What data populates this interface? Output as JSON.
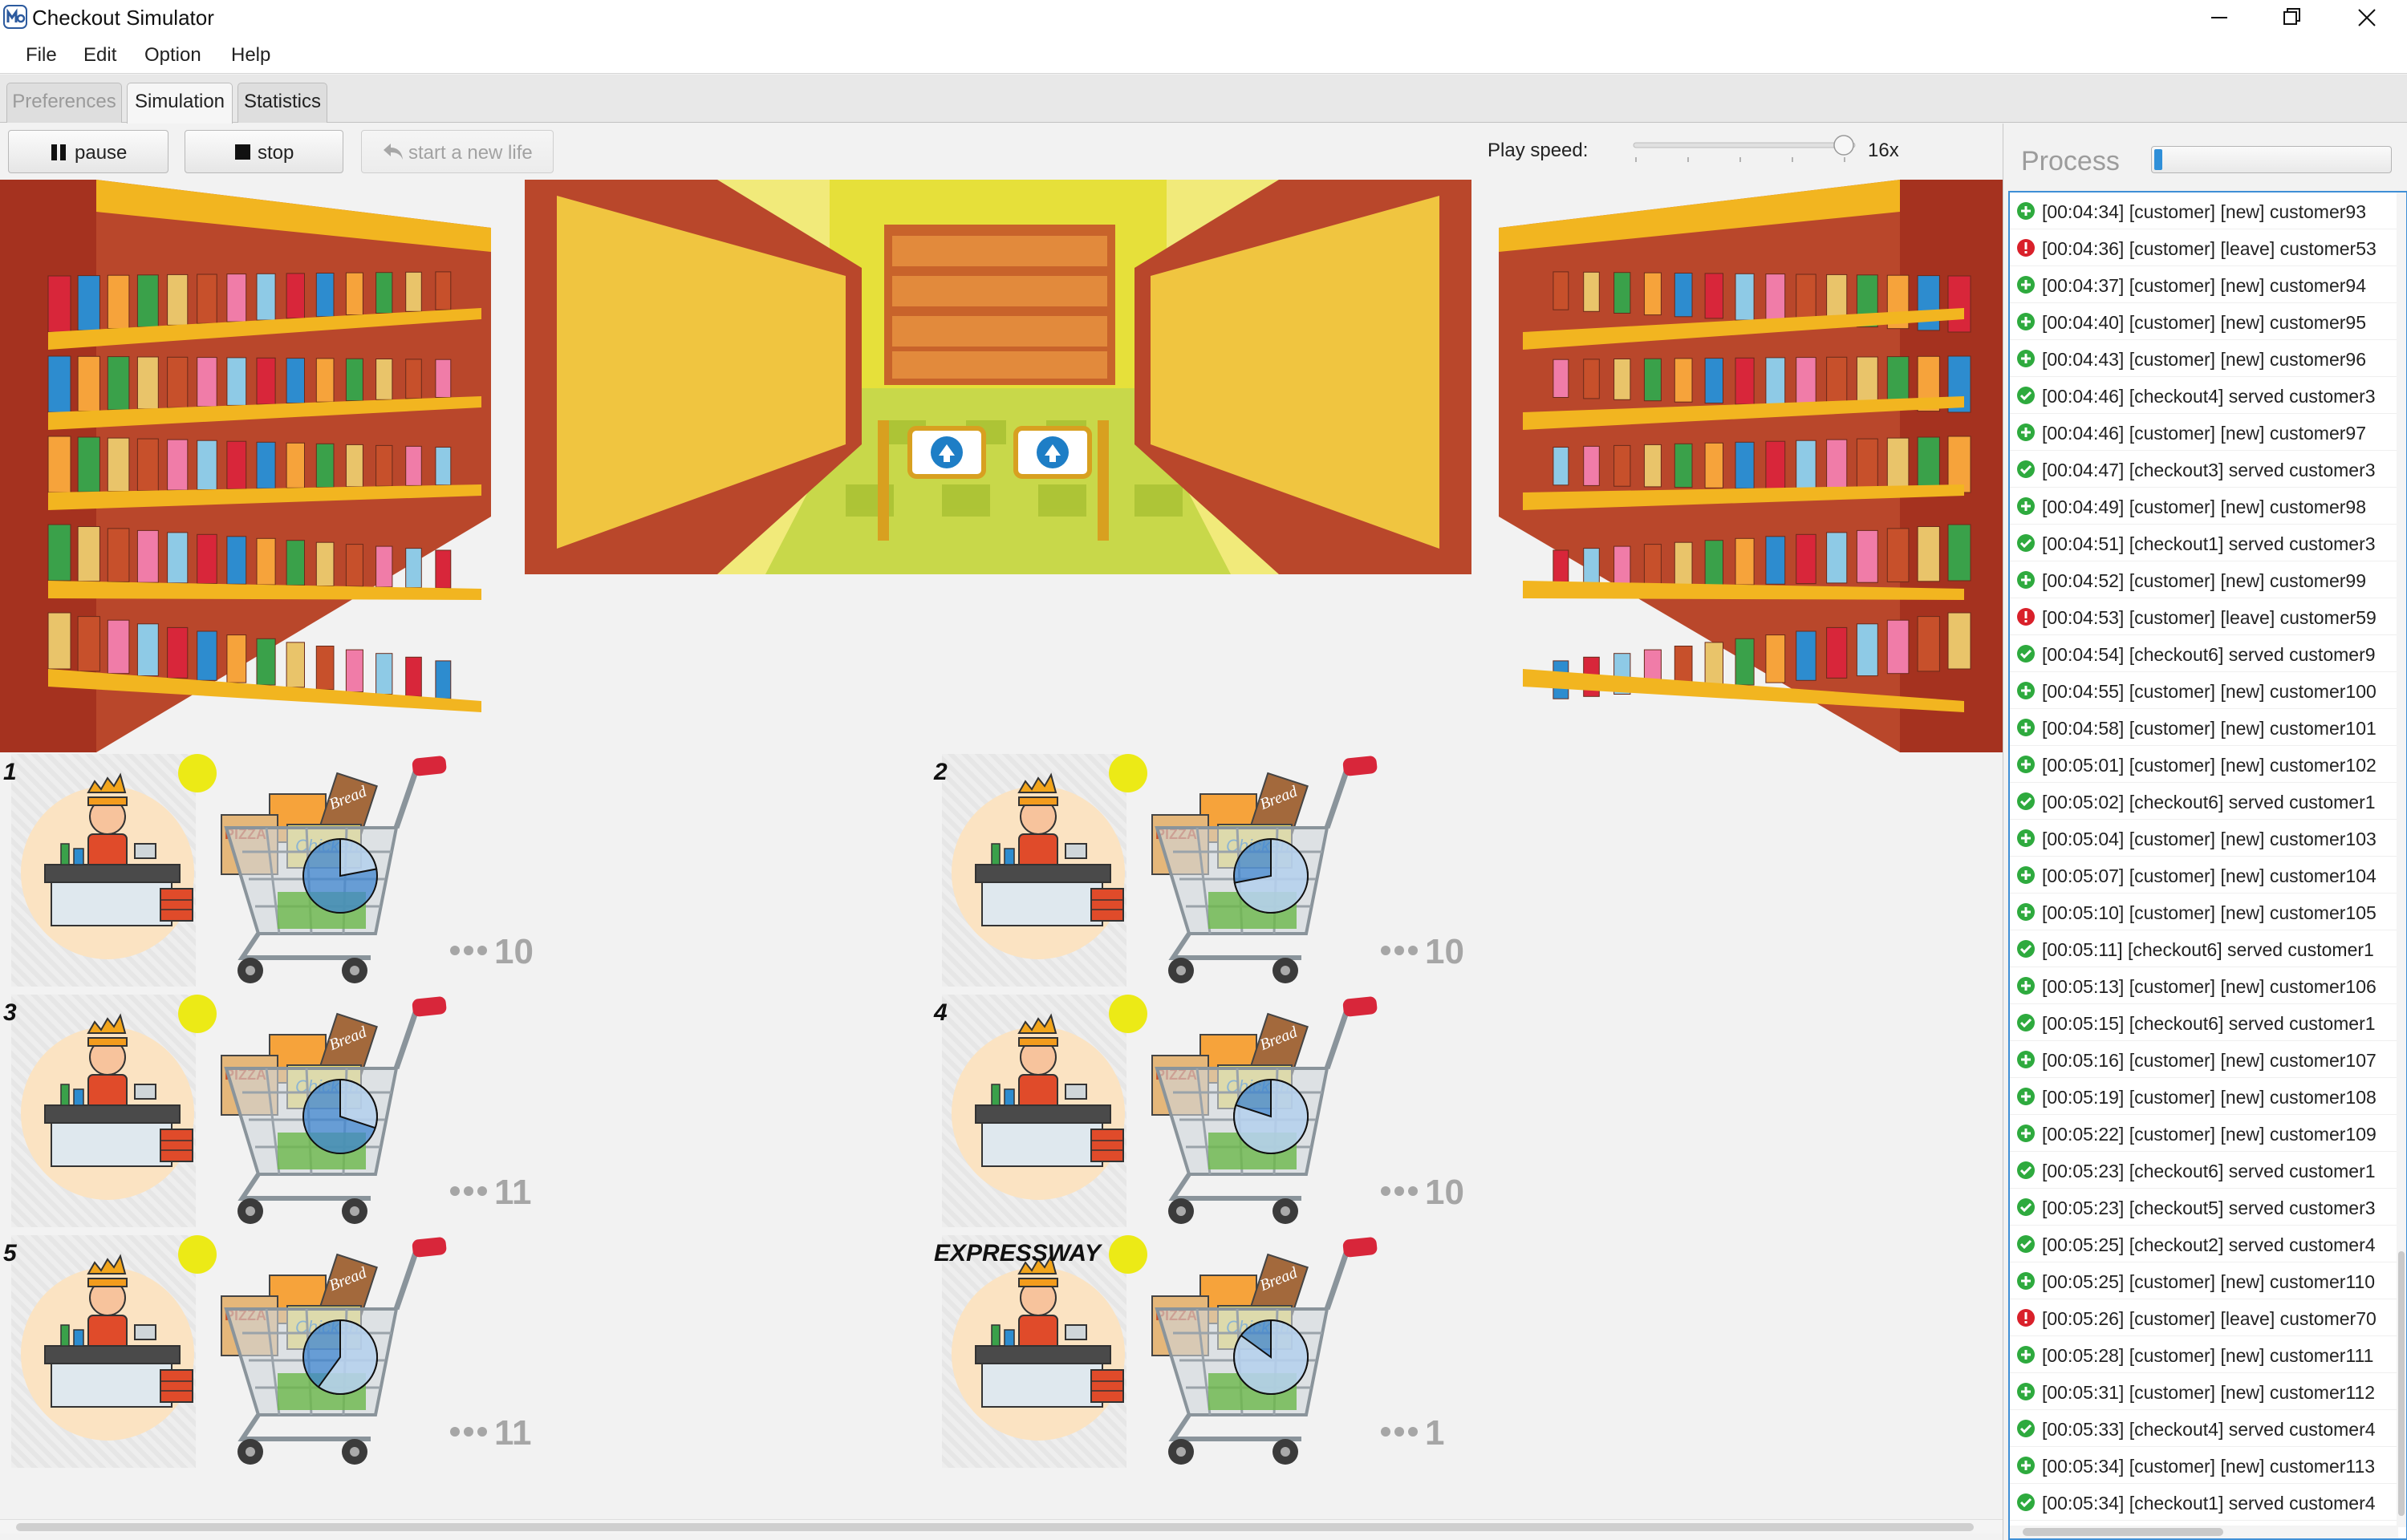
{
  "window": {
    "title": "Checkout Simulator"
  },
  "menu": {
    "file": "File",
    "edit": "Edit",
    "option": "Option",
    "help": "Help"
  },
  "tabs": {
    "preferences": "Preferences",
    "simulation": "Simulation",
    "statistics": "Statistics"
  },
  "toolbar": {
    "pause_label": "pause",
    "stop_label": "stop",
    "restart_label": "start a new life",
    "speed_label": "Play speed:",
    "speed_value": "16x",
    "speed_level": 1.0
  },
  "checkouts": [
    {
      "name": "1",
      "queue": "10"
    },
    {
      "name": "2",
      "queue": "10"
    },
    {
      "name": "3",
      "queue": "11"
    },
    {
      "name": "4",
      "queue": "10"
    },
    {
      "name": "5",
      "queue": "11"
    },
    {
      "name": "EXPRESSWAY",
      "queue": "1"
    }
  ],
  "cart_labels": {
    "chicken": "Chicken",
    "bread": "Bread",
    "pizza": "PIZZA"
  },
  "process": {
    "title": "Process",
    "progress": 0.03,
    "log": [
      {
        "type": "new",
        "text": "[00:04:34] [customer] [new] customer93"
      },
      {
        "type": "leave",
        "text": "[00:04:36] [customer] [leave] customer53"
      },
      {
        "type": "new",
        "text": "[00:04:37] [customer] [new] customer94"
      },
      {
        "type": "new",
        "text": "[00:04:40] [customer] [new] customer95"
      },
      {
        "type": "new",
        "text": "[00:04:43] [customer] [new] customer96"
      },
      {
        "type": "served",
        "text": "[00:04:46] [checkout4] served customer3"
      },
      {
        "type": "new",
        "text": "[00:04:46] [customer] [new] customer97"
      },
      {
        "type": "served",
        "text": "[00:04:47] [checkout3] served customer3"
      },
      {
        "type": "new",
        "text": "[00:04:49] [customer] [new] customer98"
      },
      {
        "type": "served",
        "text": "[00:04:51] [checkout1] served customer3"
      },
      {
        "type": "new",
        "text": "[00:04:52] [customer] [new] customer99"
      },
      {
        "type": "leave",
        "text": "[00:04:53] [customer] [leave] customer59"
      },
      {
        "type": "served",
        "text": "[00:04:54] [checkout6] served customer9"
      },
      {
        "type": "new",
        "text": "[00:04:55] [customer] [new] customer100"
      },
      {
        "type": "new",
        "text": "[00:04:58] [customer] [new] customer101"
      },
      {
        "type": "new",
        "text": "[00:05:01] [customer] [new] customer102"
      },
      {
        "type": "served",
        "text": "[00:05:02] [checkout6] served customer1"
      },
      {
        "type": "new",
        "text": "[00:05:04] [customer] [new] customer103"
      },
      {
        "type": "new",
        "text": "[00:05:07] [customer] [new] customer104"
      },
      {
        "type": "new",
        "text": "[00:05:10] [customer] [new] customer105"
      },
      {
        "type": "served",
        "text": "[00:05:11] [checkout6] served customer1"
      },
      {
        "type": "new",
        "text": "[00:05:13] [customer] [new] customer106"
      },
      {
        "type": "served",
        "text": "[00:05:15] [checkout6] served customer1"
      },
      {
        "type": "new",
        "text": "[00:05:16] [customer] [new] customer107"
      },
      {
        "type": "new",
        "text": "[00:05:19] [customer] [new] customer108"
      },
      {
        "type": "new",
        "text": "[00:05:22] [customer] [new] customer109"
      },
      {
        "type": "served",
        "text": "[00:05:23] [checkout6] served customer1"
      },
      {
        "type": "served",
        "text": "[00:05:23] [checkout5] served customer3"
      },
      {
        "type": "served",
        "text": "[00:05:25] [checkout2] served customer4"
      },
      {
        "type": "new",
        "text": "[00:05:25] [customer] [new] customer110"
      },
      {
        "type": "leave",
        "text": "[00:05:26] [customer] [leave] customer70"
      },
      {
        "type": "new",
        "text": "[00:05:28] [customer] [new] customer111"
      },
      {
        "type": "new",
        "text": "[00:05:31] [customer] [new] customer112"
      },
      {
        "type": "served",
        "text": "[00:05:33] [checkout4] served customer4"
      },
      {
        "type": "new",
        "text": "[00:05:34] [customer] [new] customer113"
      },
      {
        "type": "served",
        "text": "[00:05:34] [checkout1] served customer4"
      }
    ]
  },
  "colors": {
    "accent": "#2f8fd8",
    "status_new": "#2eaa3e",
    "status_served": "#2eaa3e",
    "status_leave": "#d9202a",
    "lane_indicator": "#ecea16",
    "queue_count": "#a6a6a6"
  },
  "icons": {
    "app": "simulator-logo-icon",
    "pause": "pause-icon",
    "stop": "stop-icon",
    "restart": "undo-arrow-icon",
    "new": "plus-circle-icon",
    "served": "check-circle-icon",
    "leave": "exclamation-circle-icon"
  }
}
